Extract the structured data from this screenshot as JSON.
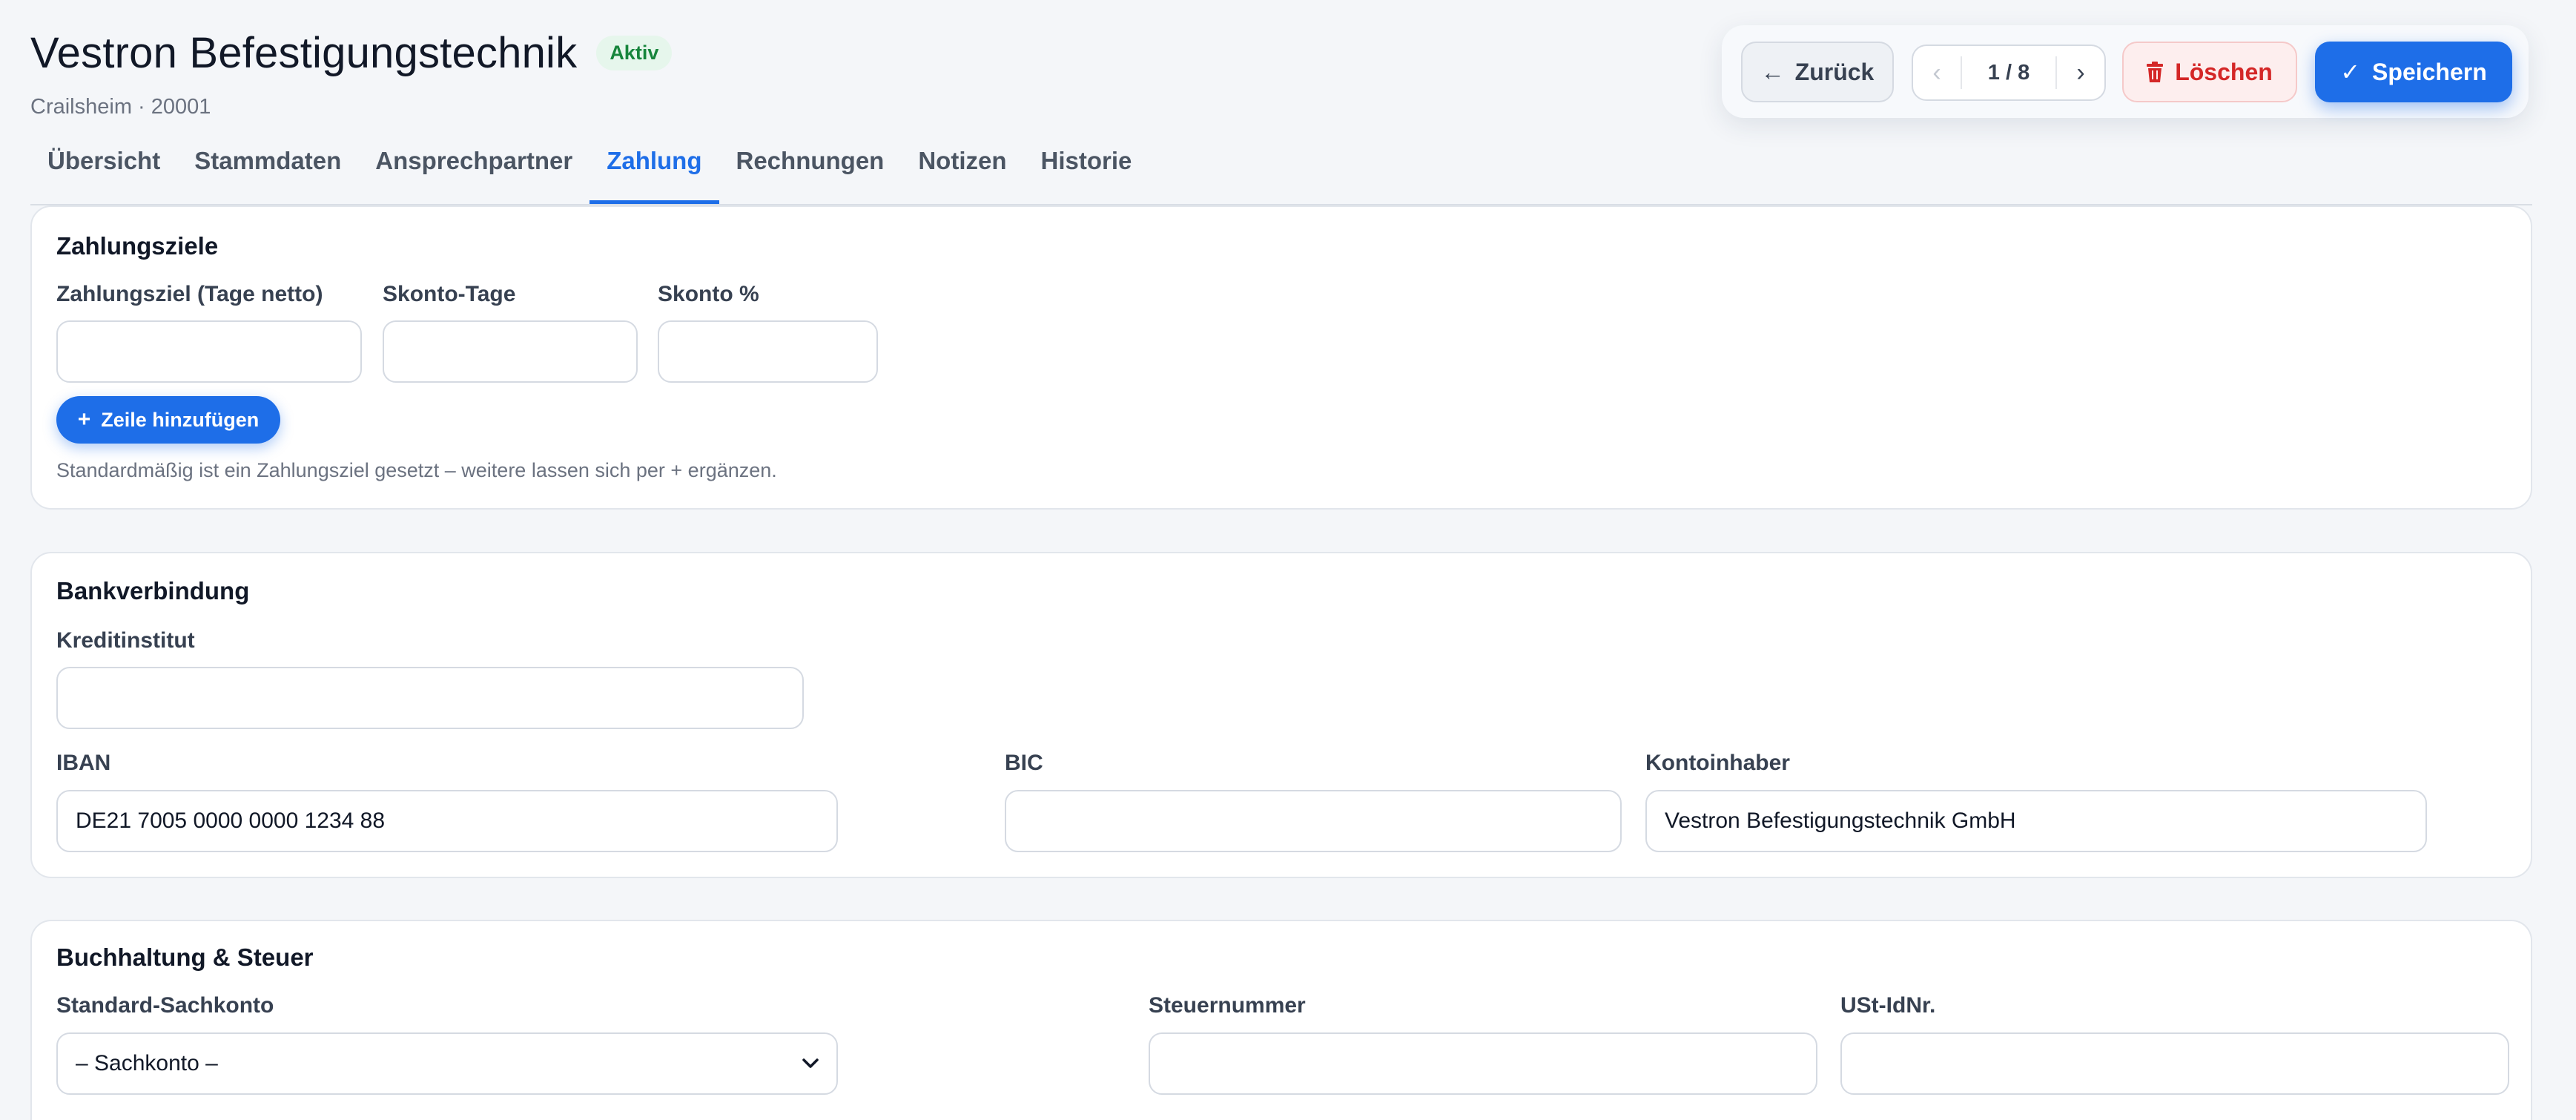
{
  "header": {
    "title": "Vestron Befestigungstechnik",
    "status": "Aktiv",
    "subtitle": "Crailsheim · 20001"
  },
  "toolbar": {
    "back_label": "Zurück",
    "pager": {
      "prev": "‹",
      "count": "1 / 8",
      "next": "›"
    },
    "delete_label": "Löschen",
    "save_label": "Speichern"
  },
  "tabs": [
    {
      "label": "Übersicht"
    },
    {
      "label": "Stammdaten"
    },
    {
      "label": "Ansprechpartner"
    },
    {
      "label": "Zahlung",
      "active": true
    },
    {
      "label": "Rechnungen"
    },
    {
      "label": "Notizen"
    },
    {
      "label": "Historie"
    }
  ],
  "zahlungsziele": {
    "title": "Zahlungsziele",
    "fields": {
      "netto_label": "Zahlungsziel (Tage netto)",
      "netto_value": "",
      "skonto_tage_label": "Skonto-Tage",
      "skonto_tage_value": "",
      "skonto_pct_label": "Skonto %",
      "skonto_pct_value": ""
    },
    "add_button": "Zeile hinzufügen",
    "hint": "Standardmäßig ist ein Zahlungsziel gesetzt – weitere lassen sich per  +  ergänzen."
  },
  "bank": {
    "title": "Bankverbindung",
    "kreditinstitut_label": "Kreditinstitut",
    "kreditinstitut_value": "",
    "iban_label": "IBAN",
    "iban_value": "DE21 7005 0000 0000 1234 88",
    "bic_label": "BIC",
    "bic_value": "",
    "inhaber_label": "Kontoinhaber",
    "inhaber_value": "Vestron Befestigungstechnik GmbH"
  },
  "buchhaltung": {
    "title": "Buchhaltung & Steuer",
    "sachkonto_label": "Standard-Sachkonto",
    "sachkonto_value": "– Sachkonto –",
    "steuernummer_label": "Steuernummer",
    "steuernummer_value": "",
    "ustid_label": "USt-IdNr.",
    "ustid_value": ""
  },
  "colors": {
    "accent": "#1e6ee8",
    "danger": "#d42727",
    "success": "#17853c",
    "background": "#f4f6f9"
  }
}
